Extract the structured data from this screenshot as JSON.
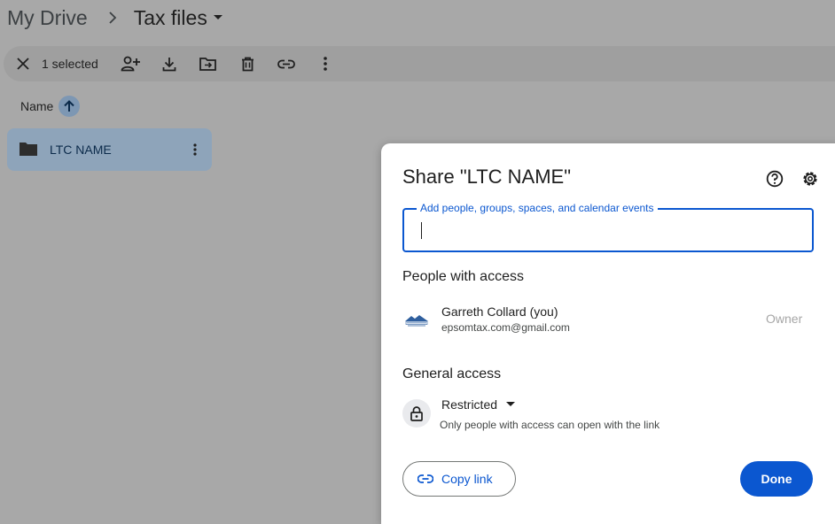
{
  "breadcrumb": {
    "root": "My Drive",
    "separator_icon": "chevron-right-icon",
    "current": "Tax files",
    "current_icon": "caret-down-icon"
  },
  "toolbar": {
    "selected_count": "1 selected",
    "actions": [
      "close-icon",
      "share-icon",
      "download-icon",
      "move-icon",
      "trash-icon",
      "link-icon",
      "more-vert-icon"
    ]
  },
  "list": {
    "column_name": "Name",
    "sort_icon": "arrow-up-icon",
    "items": [
      {
        "name": "LTC NAME",
        "icon": "folder-icon",
        "selected": true
      }
    ]
  },
  "dialog": {
    "title": "Share \"LTC NAME\"",
    "input": {
      "label": "Add people, groups, spaces, and calendar events",
      "value": ""
    },
    "people_heading": "People with access",
    "people": [
      {
        "name": "Garreth Collard (you)",
        "email": "epsomtax.com@gmail.com",
        "role": "Owner"
      }
    ],
    "general_heading": "General access",
    "access": {
      "value": "Restricted",
      "description": "Only people with access can open with the link"
    },
    "copy_link_label": "Copy link",
    "done_label": "Done"
  },
  "colors": {
    "accent": "#0b57d0",
    "scrim": "#a8a8a8",
    "selected_row": "#8ea4ba"
  }
}
